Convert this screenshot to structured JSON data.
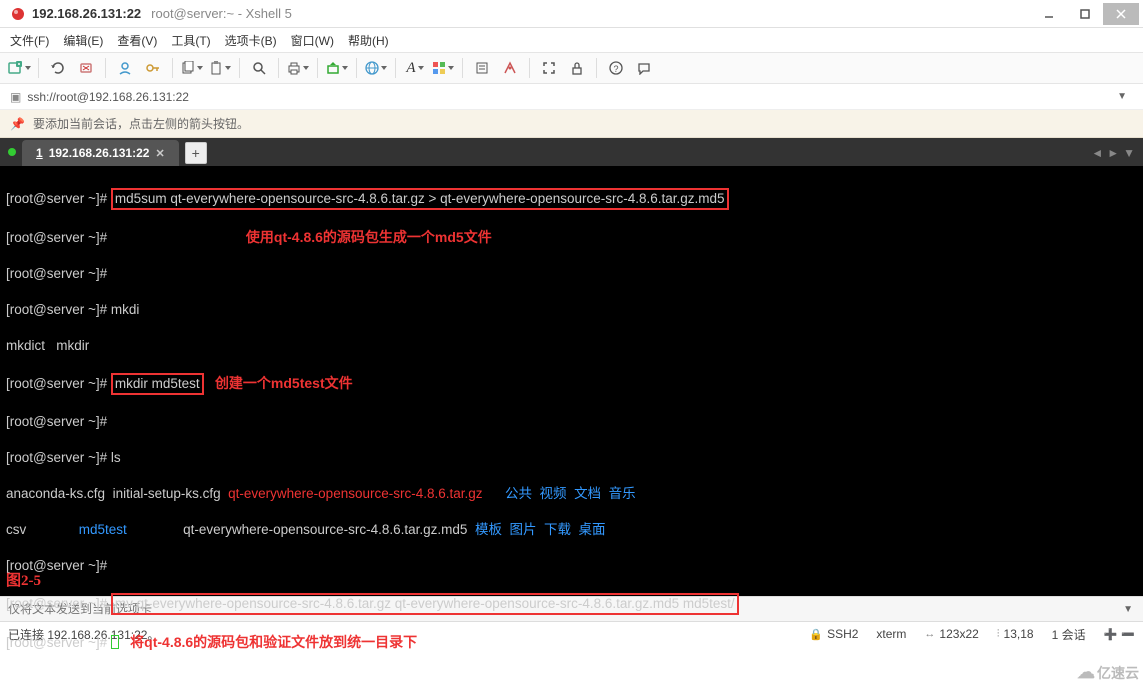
{
  "title_bar": {
    "address": "192.168.26.131:22",
    "subtitle": "root@server:~ - Xshell 5"
  },
  "menu": {
    "file": "文件(F)",
    "edit": "编辑(E)",
    "view": "查看(V)",
    "tools": "工具(T)",
    "tabs": "选项卡(B)",
    "window": "窗口(W)",
    "help": "帮助(H)"
  },
  "address_bar": {
    "url": "ssh://root@192.168.26.131:22"
  },
  "hint_bar": {
    "text": "要添加当前会话，点击左侧的箭头按钮。"
  },
  "tabs": {
    "active_num": "1",
    "active_label": "192.168.26.131:22"
  },
  "terminal": {
    "prompt": "[root@server ~]#",
    "cmd_md5sum": "md5sum qt-everywhere-opensource-src-4.8.6.tar.gz > qt-everywhere-opensource-src-4.8.6.tar.gz.md5",
    "anno_md5sum": "使用qt-4.8.6的源码包生成一个md5文件",
    "cmd_mkdi": "mkdi",
    "completion": "mkdict   mkdir",
    "cmd_mkdir": "mkdir md5test",
    "anno_mkdir": "创建一个md5test文件",
    "cmd_ls": "ls",
    "ls_row1": {
      "c1": "anaconda-ks.cfg",
      "c2": "initial-setup-ks.cfg",
      "c3": "qt-everywhere-opensource-src-4.8.6.tar.gz",
      "c4": "公共",
      "c5": "视频",
      "c6": "文档",
      "c7": "音乐"
    },
    "ls_row2": {
      "c1": "csv",
      "c2": "md5test",
      "c3": "qt-everywhere-opensource-src-4.8.6.tar.gz.md5",
      "c4": "模板",
      "c5": "图片",
      "c6": "下载",
      "c7": "桌面"
    },
    "cmd_mv": "mv qt-everywhere-opensource-src-4.8.6.tar.gz qt-everywhere-opensource-src-4.8.6.tar.gz.md5 md5test/",
    "anno_mv": "将qt-4.8.6的源码包和验证文件放到统一目录下",
    "fig_label": "图2-5"
  },
  "send_bar": {
    "placeholder": "仅将文本发送到当前选项卡"
  },
  "status_bar": {
    "connected": "已连接 192.168.26.131:22。",
    "ssh": "SSH2",
    "term": "xterm",
    "size": "123x22",
    "pos": "13,18",
    "session": "1 会话"
  },
  "watermark": "亿速云"
}
